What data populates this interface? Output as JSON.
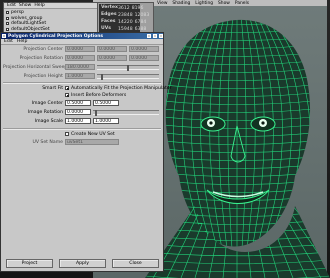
{
  "outliner": {
    "menu": [
      "Edit",
      "Show",
      "Help"
    ],
    "items": [
      {
        "label": "persp"
      },
      {
        "label": "wolves_group"
      },
      {
        "label": "defaultLightSet"
      },
      {
        "label": "defaultObjectSet"
      }
    ]
  },
  "channelbox": {
    "attributes": [
      {
        "label": "Vertex"
      },
      {
        "label": "Edges"
      },
      {
        "label": "Faces"
      },
      {
        "label": "UVs"
      }
    ],
    "values": [
      {
        "a": "3612",
        "b": "8196"
      },
      {
        "a": "23848",
        "b": "12083"
      },
      {
        "a": "14220",
        "b": "6784"
      },
      {
        "a": "15948",
        "b": "6388"
      }
    ]
  },
  "viewport": {
    "menu": [
      "View",
      "Shading",
      "Lighting",
      "Show",
      "Panels"
    ]
  },
  "dialog": {
    "title": "Polygon Cylindrical Projection Options",
    "menu": [
      "Edit",
      "Help"
    ],
    "fields": {
      "projection_center_label": "Projection Center",
      "projection_center": [
        "0.0000",
        "0.0000",
        "0.0000"
      ],
      "projection_rotation_label": "Projection Rotation",
      "projection_rotation": [
        "0.0000",
        "0.0000",
        "0.0000"
      ],
      "projection_horizontal_sweep_label": "Projection Horizontal Sweep",
      "projection_horizontal_sweep": "180.0000",
      "projection_height_label": "Projection Height",
      "projection_height": "1.0000",
      "smart_fit_label": "Smart Fit",
      "smart_fit_option": "Automatically Fit the Projection Manipulator",
      "insert_before_deformers": "Insert Before Deformers",
      "image_center_label": "Image Center",
      "image_center": [
        "0.5000",
        "0.5000"
      ],
      "image_rotation_label": "Image Rotation",
      "image_rotation": "0.0000",
      "image_scale_label": "Image Scale",
      "image_scale": [
        "1.0000",
        "1.0000"
      ],
      "create_new_uv_set": "Create New UV Set",
      "uv_set_name_label": "UV Set Name",
      "uv_set_name": "uvSet1"
    },
    "buttons": {
      "project": "Project",
      "apply": "Apply",
      "close": "Close"
    }
  },
  "colors": {
    "wireframe": "#22d37a",
    "titlebar": "#0a246a",
    "viewport_bg": "#5e6b6a"
  }
}
